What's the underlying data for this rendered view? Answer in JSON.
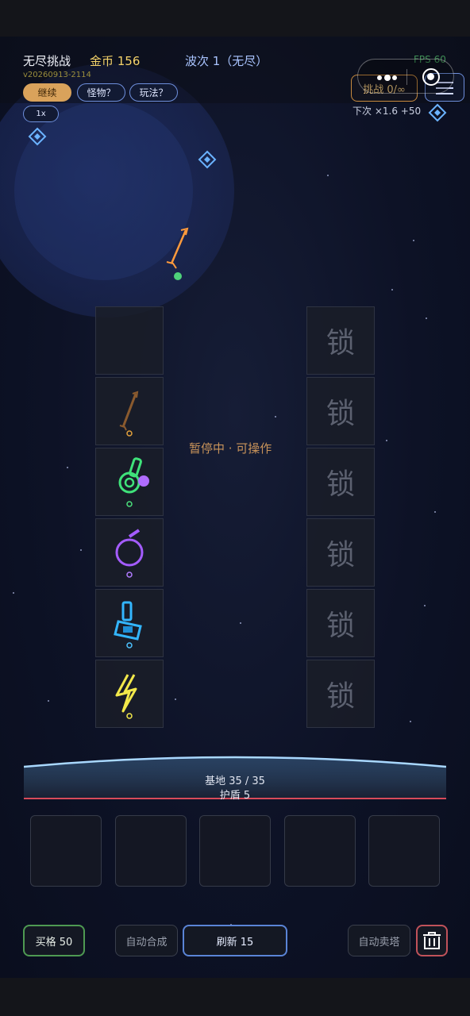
{
  "header": {
    "title": "无尽挑战",
    "gold": "金币 156",
    "wave": "波次 1（无尽）",
    "fps": "FPS 60",
    "version": "v20260913-2114"
  },
  "buttons": {
    "continue": "继续",
    "monsters": "怪物？",
    "howto": "玩法？",
    "speed": "1x",
    "challenge": "挑战 0/∞",
    "next_info": "下次 ×1.6  +50"
  },
  "board": {
    "status": "暂停中 · 可操作",
    "lock_label": "锁",
    "towers": [
      {
        "slot": 1,
        "type": "empty"
      },
      {
        "slot": 2,
        "type": "bow-tower",
        "color": "#8a5a2e"
      },
      {
        "slot": 3,
        "type": "poison-cannon-tower",
        "color": "#3fe27a"
      },
      {
        "slot": 4,
        "type": "arcane-orb-tower",
        "color": "#a45cff"
      },
      {
        "slot": 5,
        "type": "frost-cannon-tower",
        "color": "#33b6ff"
      },
      {
        "slot": 6,
        "type": "lightning-tower",
        "color": "#f2e84a"
      }
    ]
  },
  "base": {
    "hp": "基地 35 / 35",
    "shield": "护盾 5"
  },
  "footer": {
    "buy_slot": "买格 50",
    "auto_merge": "自动合成",
    "refresh": "刷新 15",
    "auto_sell": "自动卖塔"
  },
  "colors": {
    "gold": "#f5d36a",
    "accent_blue": "#6e8fdc",
    "continue_bg": "#d9a25b",
    "challenge_border": "#c78a3f",
    "buy_border": "#4e9a52",
    "sell_border": "#c0525a"
  }
}
